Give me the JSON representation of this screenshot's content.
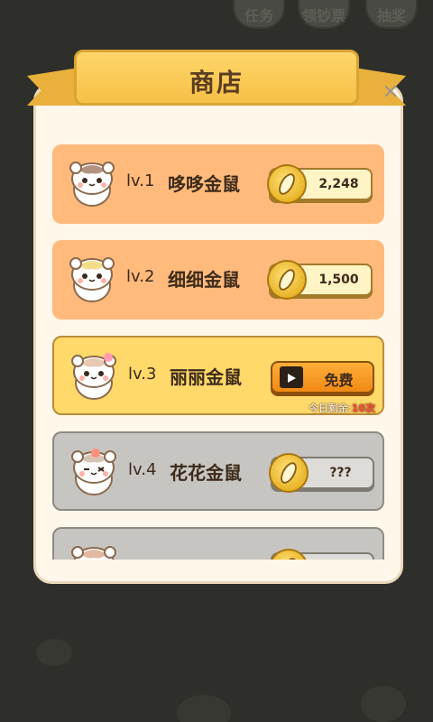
{
  "background": {
    "top_buttons": [
      {
        "label": "任务"
      },
      {
        "label": "领钞票"
      },
      {
        "label": "抽奖"
      }
    ]
  },
  "shop": {
    "title": "商店",
    "items": [
      {
        "level": "lv.1",
        "name": "哆哆金鼠",
        "price": "2,248",
        "state": "buy"
      },
      {
        "level": "lv.2",
        "name": "细细金鼠",
        "price": "1,500",
        "state": "buy"
      },
      {
        "level": "lv.3",
        "name": "丽丽金鼠",
        "button": "免费",
        "remain_prefix": "今日剩余:",
        "remain_count": "10次",
        "state": "free"
      },
      {
        "level": "lv.4",
        "name": "花花金鼠",
        "price": "???",
        "state": "locked"
      }
    ]
  },
  "colors": {
    "card_buy": "#ffba7c",
    "card_free": "#ffd96a",
    "card_locked": "#c7c5c1",
    "banner": "#f6c046"
  }
}
